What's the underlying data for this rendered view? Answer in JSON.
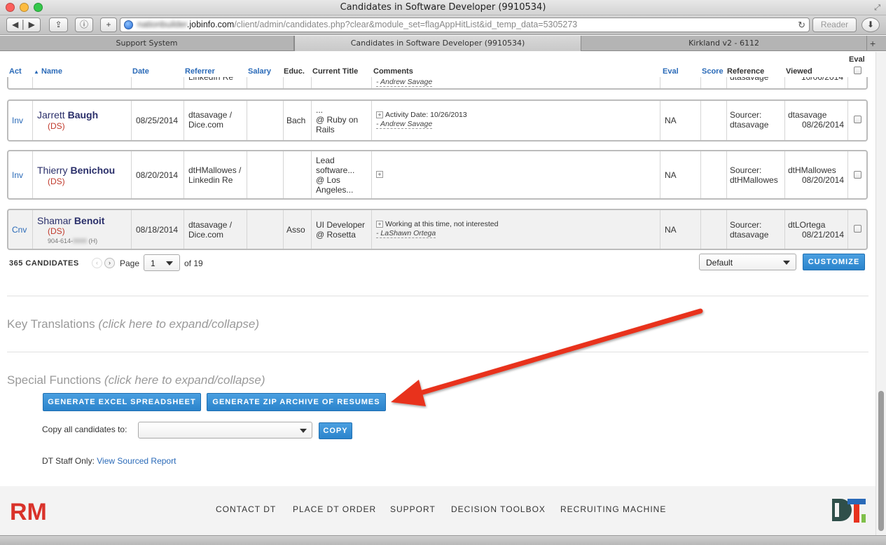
{
  "window": {
    "title": "Candidates in Software Developer (9910534)"
  },
  "toolbar": {
    "url_blurred": "nationbuilder",
    "url_domain": ".jobinfo.com",
    "url_path": "/client/admin/candidates.php?clear&module_set=flagAppHitList&id_temp_data=5305273",
    "reader_label": "Reader"
  },
  "tabs": [
    {
      "label": "Support System"
    },
    {
      "label": "Candidates in Software Developer (9910534)"
    },
    {
      "label": "Kirkland v2 - 6112"
    }
  ],
  "table": {
    "headers": {
      "act": "Act",
      "name": "Name",
      "date": "Date",
      "referrer": "Referrer",
      "salary": "Salary",
      "educ": "Educ.",
      "title": "Current Title",
      "comments": "Comments",
      "eval": "Eval",
      "score": "Score",
      "reference": "Reference",
      "viewed": "Viewed",
      "eval_check": "Eval"
    },
    "partial_row": {
      "referrer": "LinkedIn Re",
      "comment_by": "- Andrew Savage",
      "reference": "dtasavage",
      "viewed": "10/06/2014"
    },
    "rows": [
      {
        "act": "Inv",
        "first": "Jarrett",
        "last": "Baugh",
        "tag": "(DS)",
        "phone": "",
        "date": "08/25/2014",
        "referrer1": "dtasavage /",
        "referrer2": "Dice.com",
        "salary": "",
        "educ": "Bach",
        "title1": "...",
        "title2": "@ Ruby on",
        "title3": "Rails",
        "title4": "",
        "comment": "Activity Date: 10/26/2013",
        "comment_by": "- Andrew Savage",
        "eval": "NA",
        "score": "",
        "ref1": "Sourcer:",
        "ref2": "dtasavage",
        "viewed_by": "dtasavage",
        "viewed_date": "08/26/2014"
      },
      {
        "act": "Inv",
        "first": "Thierry",
        "last": "Benichou",
        "tag": "(DS)",
        "phone": "",
        "date": "08/20/2014",
        "referrer1": "dtHMallowes /",
        "referrer2": "Linkedin Re",
        "salary": "",
        "educ": "",
        "title1": "Lead",
        "title2": "software...",
        "title3": "@ Los",
        "title4": "Angeles...",
        "comment": "",
        "comment_by": "",
        "eval": "NA",
        "score": "",
        "ref1": "Sourcer:",
        "ref2": "dtHMallowes",
        "viewed_by": "dtHMallowes",
        "viewed_date": "08/20/2014"
      },
      {
        "act": "Cnv",
        "first": "Shamar",
        "last": "Benoit",
        "tag": "(DS)",
        "phone": "904-614-",
        "phone_suffix": "(H)",
        "date": "08/18/2014",
        "referrer1": "dtasavage /",
        "referrer2": "Dice.com",
        "salary": "",
        "educ": "Asso",
        "title1": "UI Developer",
        "title2": "@ Rosetta",
        "title3": "",
        "title4": "",
        "comment": "Working at this time, not interested",
        "comment_by": "- LaShawn Ortega",
        "eval": "NA",
        "score": "",
        "ref1": "Sourcer:",
        "ref2": "dtasavage",
        "viewed_by": "dtLOrtega",
        "viewed_date": "08/21/2014"
      }
    ]
  },
  "pager": {
    "count": "365 CANDIDATES",
    "page_label": "Page",
    "page_value": "1",
    "of_label": "of 19",
    "view_value": "Default",
    "customize_label": "CUSTOMIZE"
  },
  "sections": {
    "key_title": "Key Translations",
    "key_hint": "(click here to expand/collapse)",
    "special_title": "Special Functions",
    "special_hint": "(click here to expand/collapse)"
  },
  "special": {
    "excel_label": "GENERATE EXCEL SPREADSHEET",
    "zip_label": "GENERATE ZIP ARCHIVE OF RESUMES",
    "copy_label": "Copy all candidates to:",
    "copy_value": "",
    "copy_button": "COPY",
    "staff_label": "DT Staff Only:",
    "staff_link": "View Sourced Report"
  },
  "footer": {
    "logo_left": "RM",
    "nav": [
      "CONTACT DT",
      "PLACE DT ORDER",
      "SUPPORT",
      "DECISION TOOLBOX",
      "RECRUITING MACHINE"
    ],
    "logo_right": "DT"
  },
  "colors": {
    "link": "#2a6ab8",
    "button": "#2b84cc",
    "tag": "#c0392b",
    "arrow": "#e8321e"
  },
  "icons": {
    "back": "back-icon",
    "forward": "forward-icon",
    "share": "share-icon",
    "info": "info-icon",
    "add": "add-tab-icon",
    "reload": "reload-icon",
    "download": "download-icon"
  }
}
